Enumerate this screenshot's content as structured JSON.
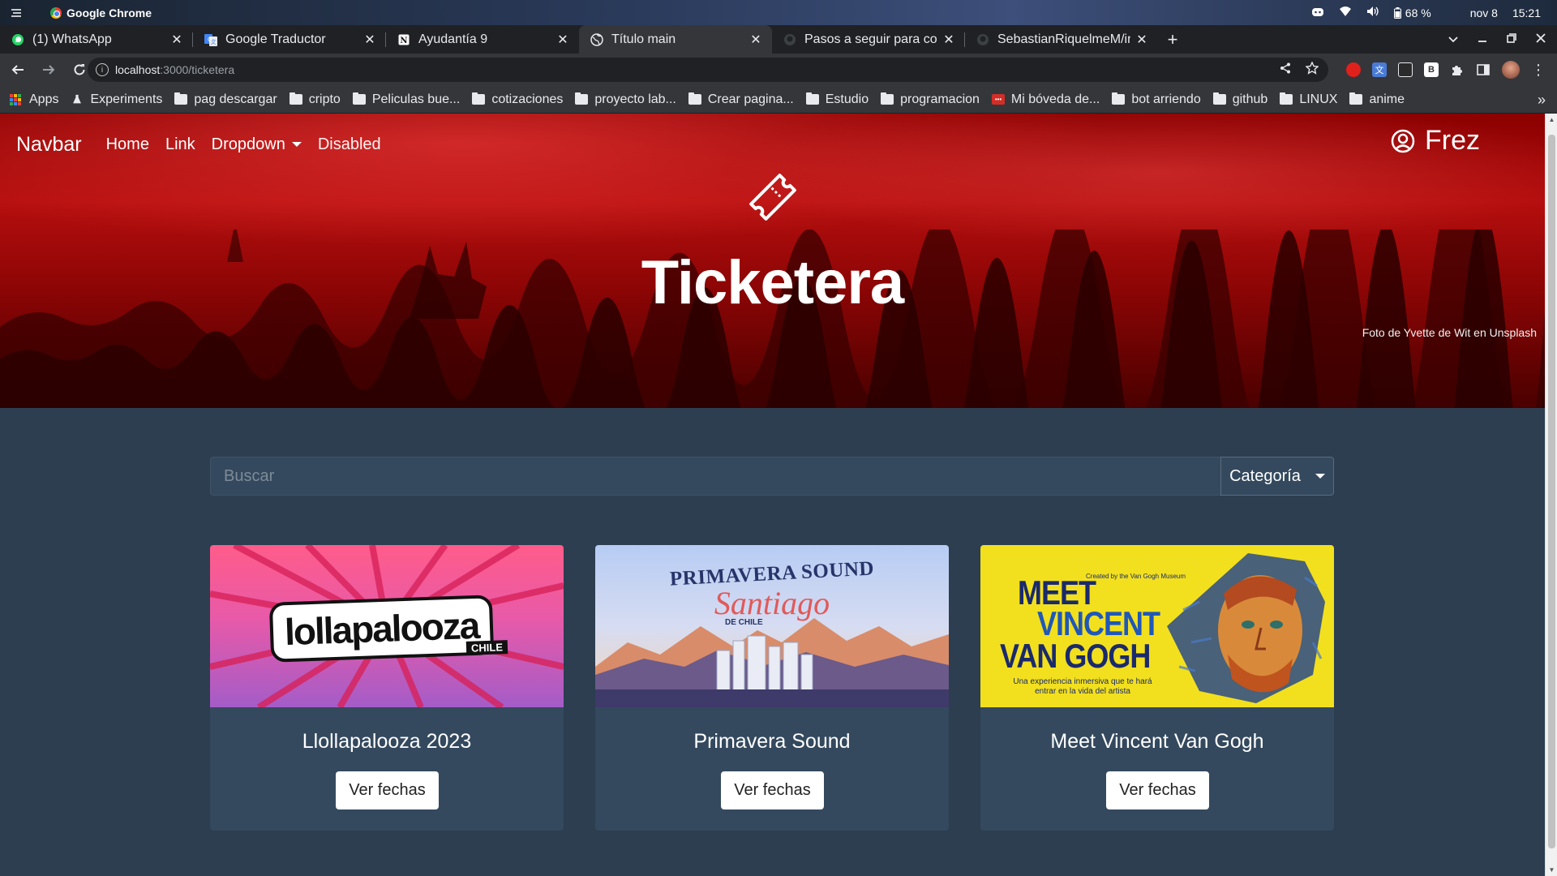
{
  "os": {
    "app_name": "Google Chrome",
    "battery": "68 %",
    "date": "nov 8",
    "time": "15:21"
  },
  "tabs": [
    {
      "title": "(1) WhatsApp",
      "favicon": "whatsapp-icon",
      "active": false
    },
    {
      "title": "Google Traductor",
      "favicon": "translate-icon",
      "active": false
    },
    {
      "title": "Ayudantía 9",
      "favicon": "notion-icon",
      "active": false
    },
    {
      "title": "Título main",
      "favicon": "globe-icon",
      "active": true
    },
    {
      "title": "Pasos a seguir para co",
      "favicon": "github-icon",
      "active": false
    },
    {
      "title": "SebastianRiquelmeM/in",
      "favicon": "github-icon",
      "active": false
    }
  ],
  "address": {
    "host": "localhost",
    "path": ":3000/ticketera"
  },
  "bookmarks": [
    {
      "label": "Apps",
      "icon": "apps-icon"
    },
    {
      "label": "Experiments",
      "icon": "flask-icon"
    },
    {
      "label": "pag descargar",
      "icon": "folder-icon"
    },
    {
      "label": "cripto",
      "icon": "folder-icon"
    },
    {
      "label": "Peliculas bue...",
      "icon": "folder-icon"
    },
    {
      "label": "cotizaciones",
      "icon": "folder-icon"
    },
    {
      "label": "proyecto lab...",
      "icon": "folder-icon"
    },
    {
      "label": "Crear pagina...",
      "icon": "folder-icon"
    },
    {
      "label": "Estudio",
      "icon": "folder-icon"
    },
    {
      "label": "programacion",
      "icon": "folder-icon"
    },
    {
      "label": "Mi bóveda de...",
      "icon": "lastpass-icon"
    },
    {
      "label": "bot arriendo",
      "icon": "folder-icon"
    },
    {
      "label": "github",
      "icon": "folder-icon"
    },
    {
      "label": "LINUX",
      "icon": "folder-icon"
    },
    {
      "label": "anime",
      "icon": "folder-icon"
    }
  ],
  "navbar": {
    "brand": "Navbar",
    "links": [
      "Home",
      "Link",
      "Dropdown",
      "Disabled"
    ],
    "user_name": "Frez"
  },
  "hero": {
    "title": "Ticketera",
    "photo_credit": "Foto de Yvette de Wit en Unsplash"
  },
  "search": {
    "placeholder": "Buscar",
    "category_label": "Categoría"
  },
  "cards": [
    {
      "title": "Llollapalooza 2023",
      "button": "Ver fechas",
      "image_text": {
        "logo": "lollapalooza",
        "sub": "CHILE"
      }
    },
    {
      "title": "Primavera Sound",
      "button": "Ver fechas",
      "image_text": {
        "line1": "PRIMAVERA SOUND",
        "line2": "Santiago",
        "line3": "DE CHILE"
      }
    },
    {
      "title": "Meet Vincent Van Gogh",
      "button": "Ver fechas",
      "image_text": {
        "line1": "MEET",
        "line2": "VINCENT",
        "line3": "VAN GOGH",
        "small": "Created by the Van Gogh Museum",
        "sub": "Una experiencia inmersiva que te hará entrar en la vida del artista"
      }
    }
  ],
  "colors": {
    "page_bg": "#2c3e50",
    "card_bg": "#34495e",
    "hero_red": "#b50e0e"
  }
}
